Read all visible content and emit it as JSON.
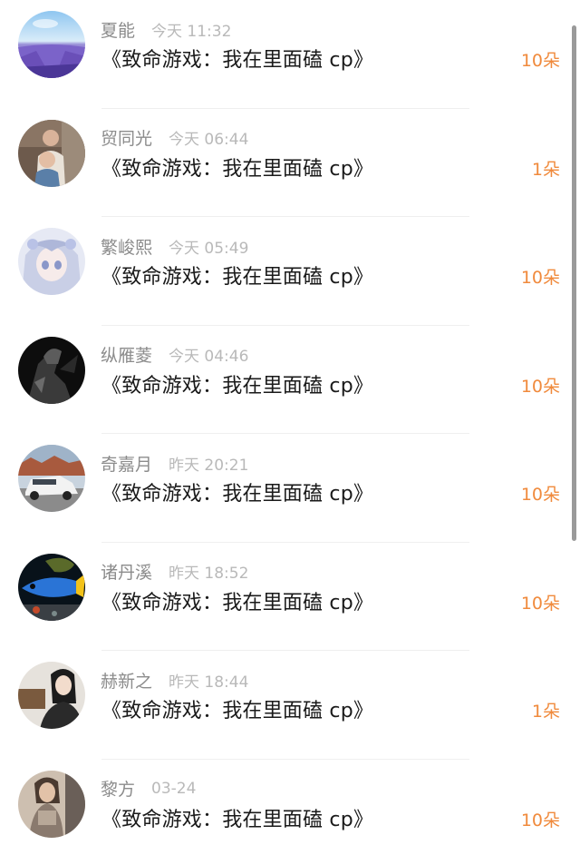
{
  "colors": {
    "accent": "#f08a3c",
    "name": "#8c8c8c",
    "time": "#b9b9b9",
    "title": "#1a1a1a"
  },
  "items": [
    {
      "name": "夏能",
      "time": "今天 11:32",
      "title": "《致命游戏：我在里面磕 cp》",
      "gift": "10朵",
      "avatar": "lavender-field-avatar"
    },
    {
      "name": "贸同光",
      "time": "今天 06:44",
      "title": "《致命游戏：我在里面磕 cp》",
      "gift": "1朵",
      "avatar": "family-photo-avatar"
    },
    {
      "name": "繁峻熙",
      "time": "今天 05:49",
      "title": "《致命游戏：我在里面磕 cp》",
      "gift": "10朵",
      "avatar": "anime-girl-avatar"
    },
    {
      "name": "纵雁菱",
      "time": "今天 04:46",
      "title": "《致命游戏：我在里面磕 cp》",
      "gift": "10朵",
      "avatar": "dark-figure-avatar"
    },
    {
      "name": "奇嘉月",
      "time": "昨天 20:21",
      "title": "《致命游戏：我在里面磕 cp》",
      "gift": "10朵",
      "avatar": "white-suv-avatar"
    },
    {
      "name": "诸丹溪",
      "time": "昨天 18:52",
      "title": "《致命游戏：我在里面磕 cp》",
      "gift": "10朵",
      "avatar": "blue-fish-avatar"
    },
    {
      "name": "赫新之",
      "time": "昨天 18:44",
      "title": "《致命游戏：我在里面磕 cp》",
      "gift": "1朵",
      "avatar": "girl-portrait-avatar"
    },
    {
      "name": "黎方",
      "time": "03-24",
      "title": "《致命游戏：我在里面磕 cp》",
      "gift": "10朵",
      "avatar": "woman-photo-avatar"
    }
  ]
}
